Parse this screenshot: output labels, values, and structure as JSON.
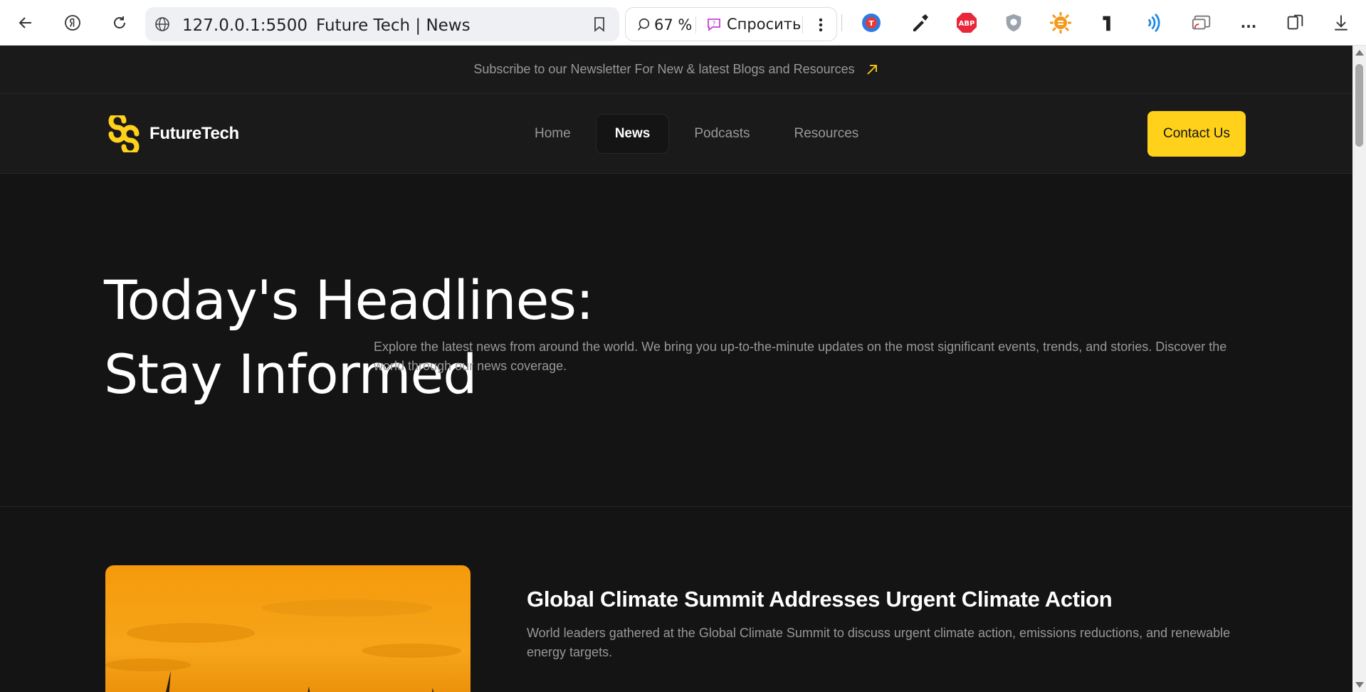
{
  "browser": {
    "url": "127.0.0.1:5500",
    "tab_title": "Future Tech | News",
    "zoom": "67 %",
    "ask_label": "Спросить",
    "more_label": "..."
  },
  "newsletter": {
    "text": "Subscribe to our Newsletter For New & latest Blogs and Resources"
  },
  "nav": {
    "brand": "FutureTech",
    "links": [
      {
        "label": "Home",
        "active": false
      },
      {
        "label": "News",
        "active": true
      },
      {
        "label": "Podcasts",
        "active": false
      },
      {
        "label": "Resources",
        "active": false
      }
    ],
    "contact_label": "Contact Us"
  },
  "hero": {
    "title": "Today's Headlines: Stay Informed",
    "description": "Explore the latest news from around the world. We bring you up-to-the-minute updates on the most significant events, trends, and stories. Discover the world through our news coverage."
  },
  "article": {
    "title": "Global Climate Summit Addresses Urgent Climate Action",
    "summary": "World leaders gathered at the Global Climate Summit to discuss urgent climate action, emissions reductions, and renewable energy targets."
  },
  "colors": {
    "accent": "#ffd11a",
    "background": "#141414",
    "muted_text": "#98989a"
  }
}
